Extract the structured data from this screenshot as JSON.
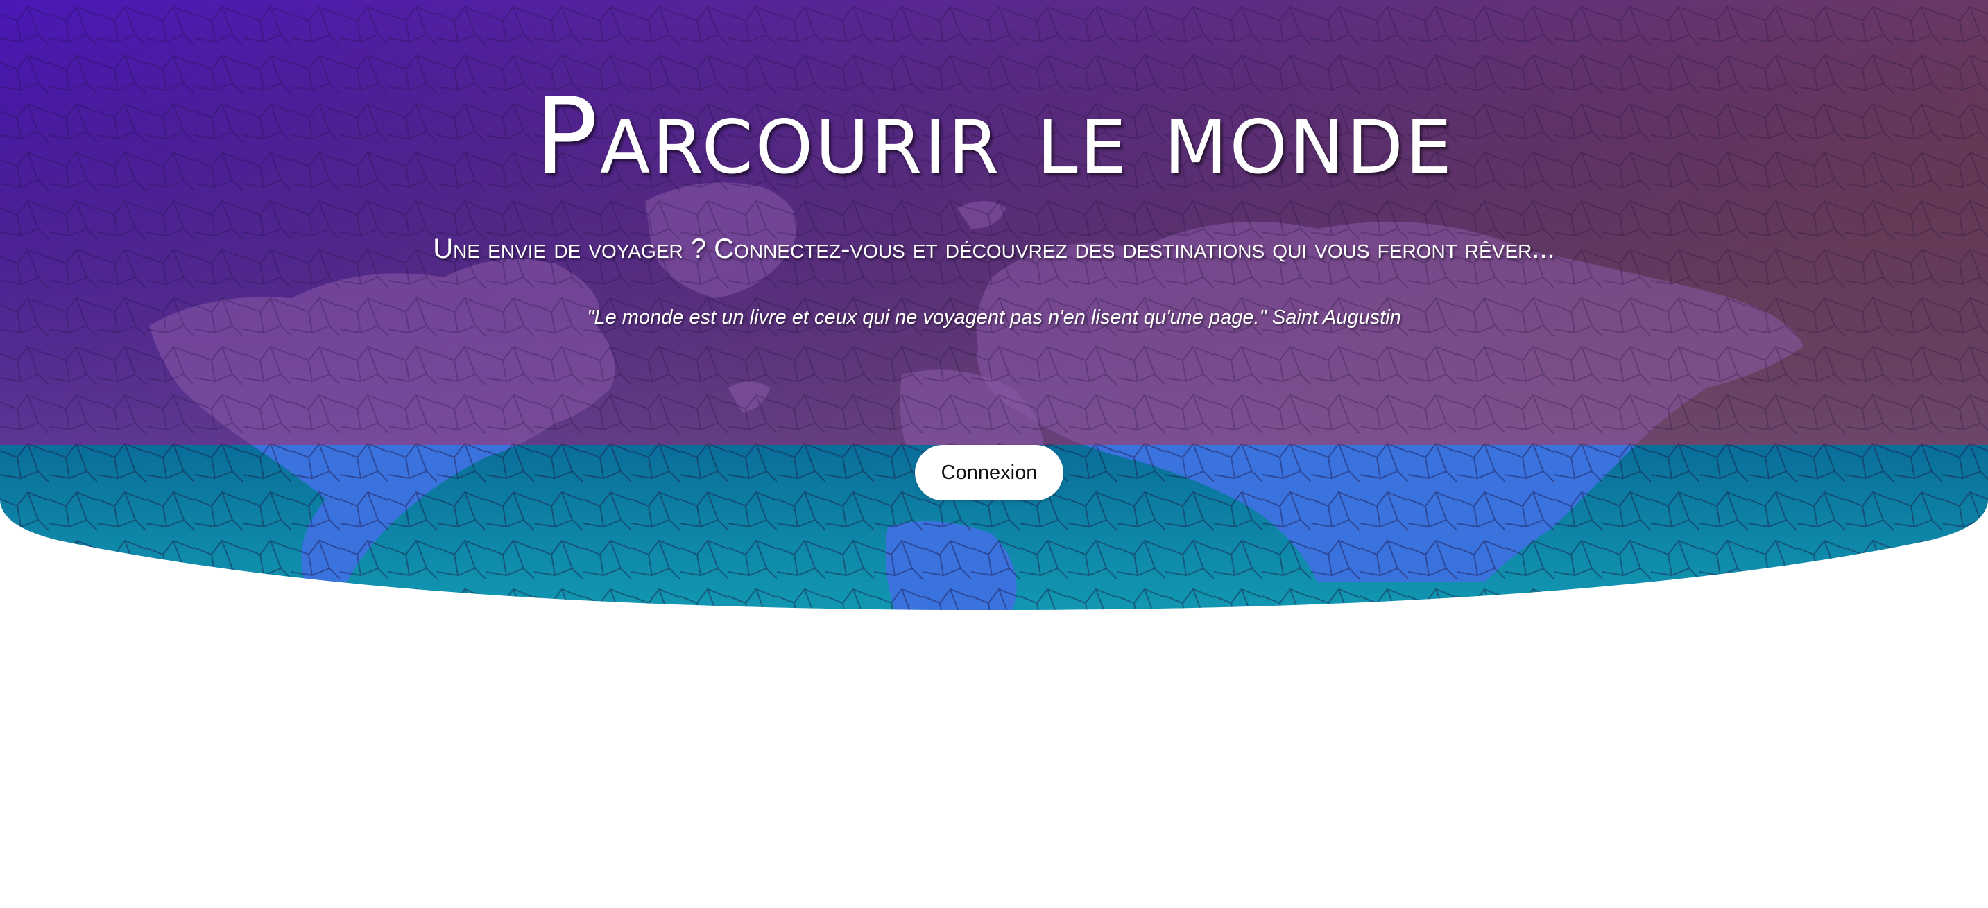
{
  "hero": {
    "title": "Parcourir le monde",
    "subtitle": "Une envie de voyager ? Connectez-vous et découvrez des destinations qui vous feront rêver...",
    "quote": "\"Le monde est un livre et ceux qui ne voyagent pas n'en lisent qu'une page.\" Saint Augustin",
    "login_label": "Connexion",
    "background_icon": "world-map-icon"
  },
  "colors": {
    "top_left": "#4a1ab5",
    "top_right": "#6b3a62",
    "band_left": "#0a6d9a",
    "band_right": "#0e92ad",
    "continents": "#3a6fd8",
    "button": "#ffffff"
  }
}
